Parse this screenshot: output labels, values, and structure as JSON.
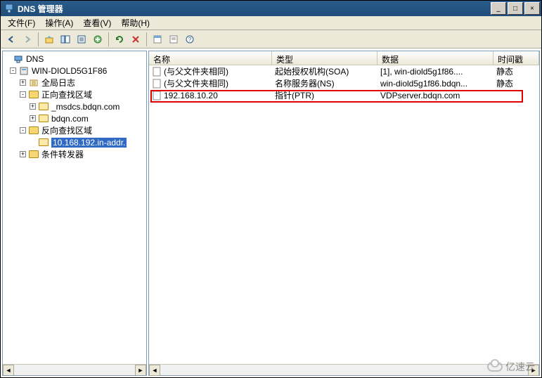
{
  "window": {
    "title": "DNS 管理器",
    "buttons": {
      "min": "_",
      "max": "□",
      "close": "×"
    }
  },
  "menu": {
    "file": "文件(F)",
    "action": "操作(A)",
    "view": "查看(V)",
    "help": "帮助(H)"
  },
  "toolbar_icons": [
    "back",
    "forward",
    "up",
    "show-hide",
    "export",
    "add",
    "refresh",
    "stop",
    "properties",
    "filter",
    "help"
  ],
  "tree": {
    "root": "DNS",
    "server": "WIN-DIOLD5G1F86",
    "global_log": "全局日志",
    "fwd_zone": "正向查找区域",
    "fwd_children": [
      "_msdcs.bdqn.com",
      "bdqn.com"
    ],
    "rev_zone": "反向查找区域",
    "rev_child": "10.168.192.in-addr.",
    "cond_fwd": "条件转发器"
  },
  "columns": {
    "name": "名称",
    "type": "类型",
    "data": "数据",
    "timestamp": "时间戳"
  },
  "records": [
    {
      "name": "(与父文件夹相同)",
      "type": "起始授权机构(SOA)",
      "data": "[1], win-diold5g1f86....",
      "timestamp": "静态"
    },
    {
      "name": "(与父文件夹相同)",
      "type": "名称服务器(NS)",
      "data": "win-diold5g1f86.bdqn...",
      "timestamp": "静态"
    },
    {
      "name": "192.168.10.20",
      "type": "指针(PTR)",
      "data": "VDPserver.bdqn.com",
      "timestamp": ""
    }
  ],
  "colors": {
    "titlebar": "#2b5b8b",
    "select": "#316ac5",
    "highlight": "#e00000"
  },
  "watermark": "亿速云"
}
